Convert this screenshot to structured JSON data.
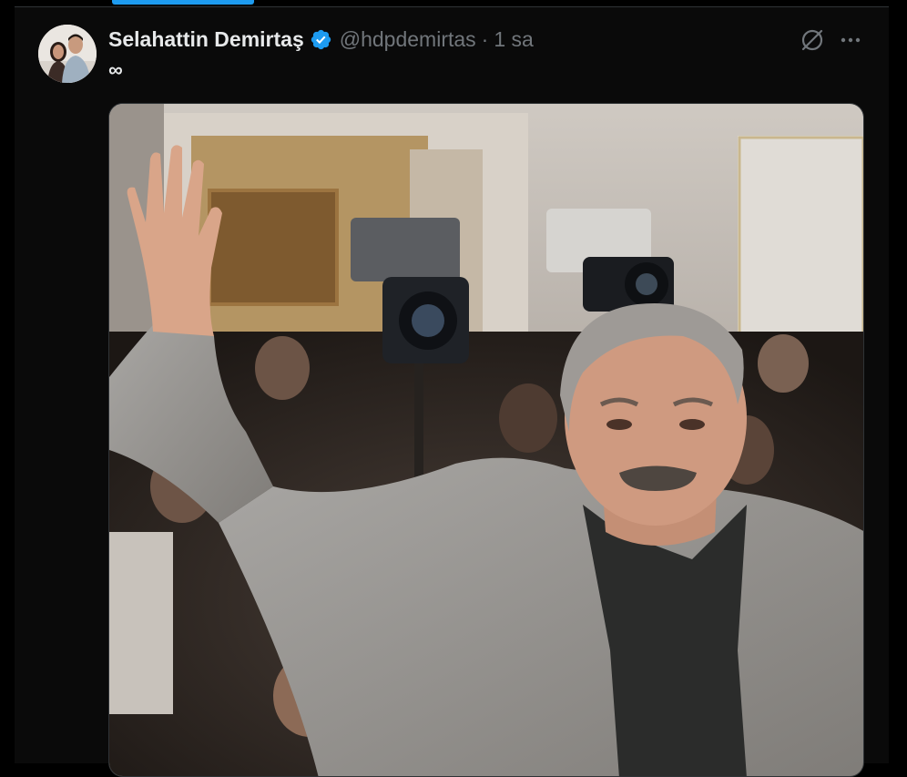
{
  "tweet": {
    "author_name": "Selahattin Demirtaş",
    "handle": "@hdpdemirtas",
    "separator": "·",
    "time": "1 sa",
    "text": "∞",
    "verified_icon": "verified-badge-icon",
    "grok_icon": "grok-icon",
    "more_icon": "more-horizontal-icon"
  },
  "colors": {
    "accent": "#1d9bf0",
    "background": "#000000",
    "text_primary": "#e7e9ea",
    "text_secondary": "#71767b",
    "border": "#2f3336"
  }
}
